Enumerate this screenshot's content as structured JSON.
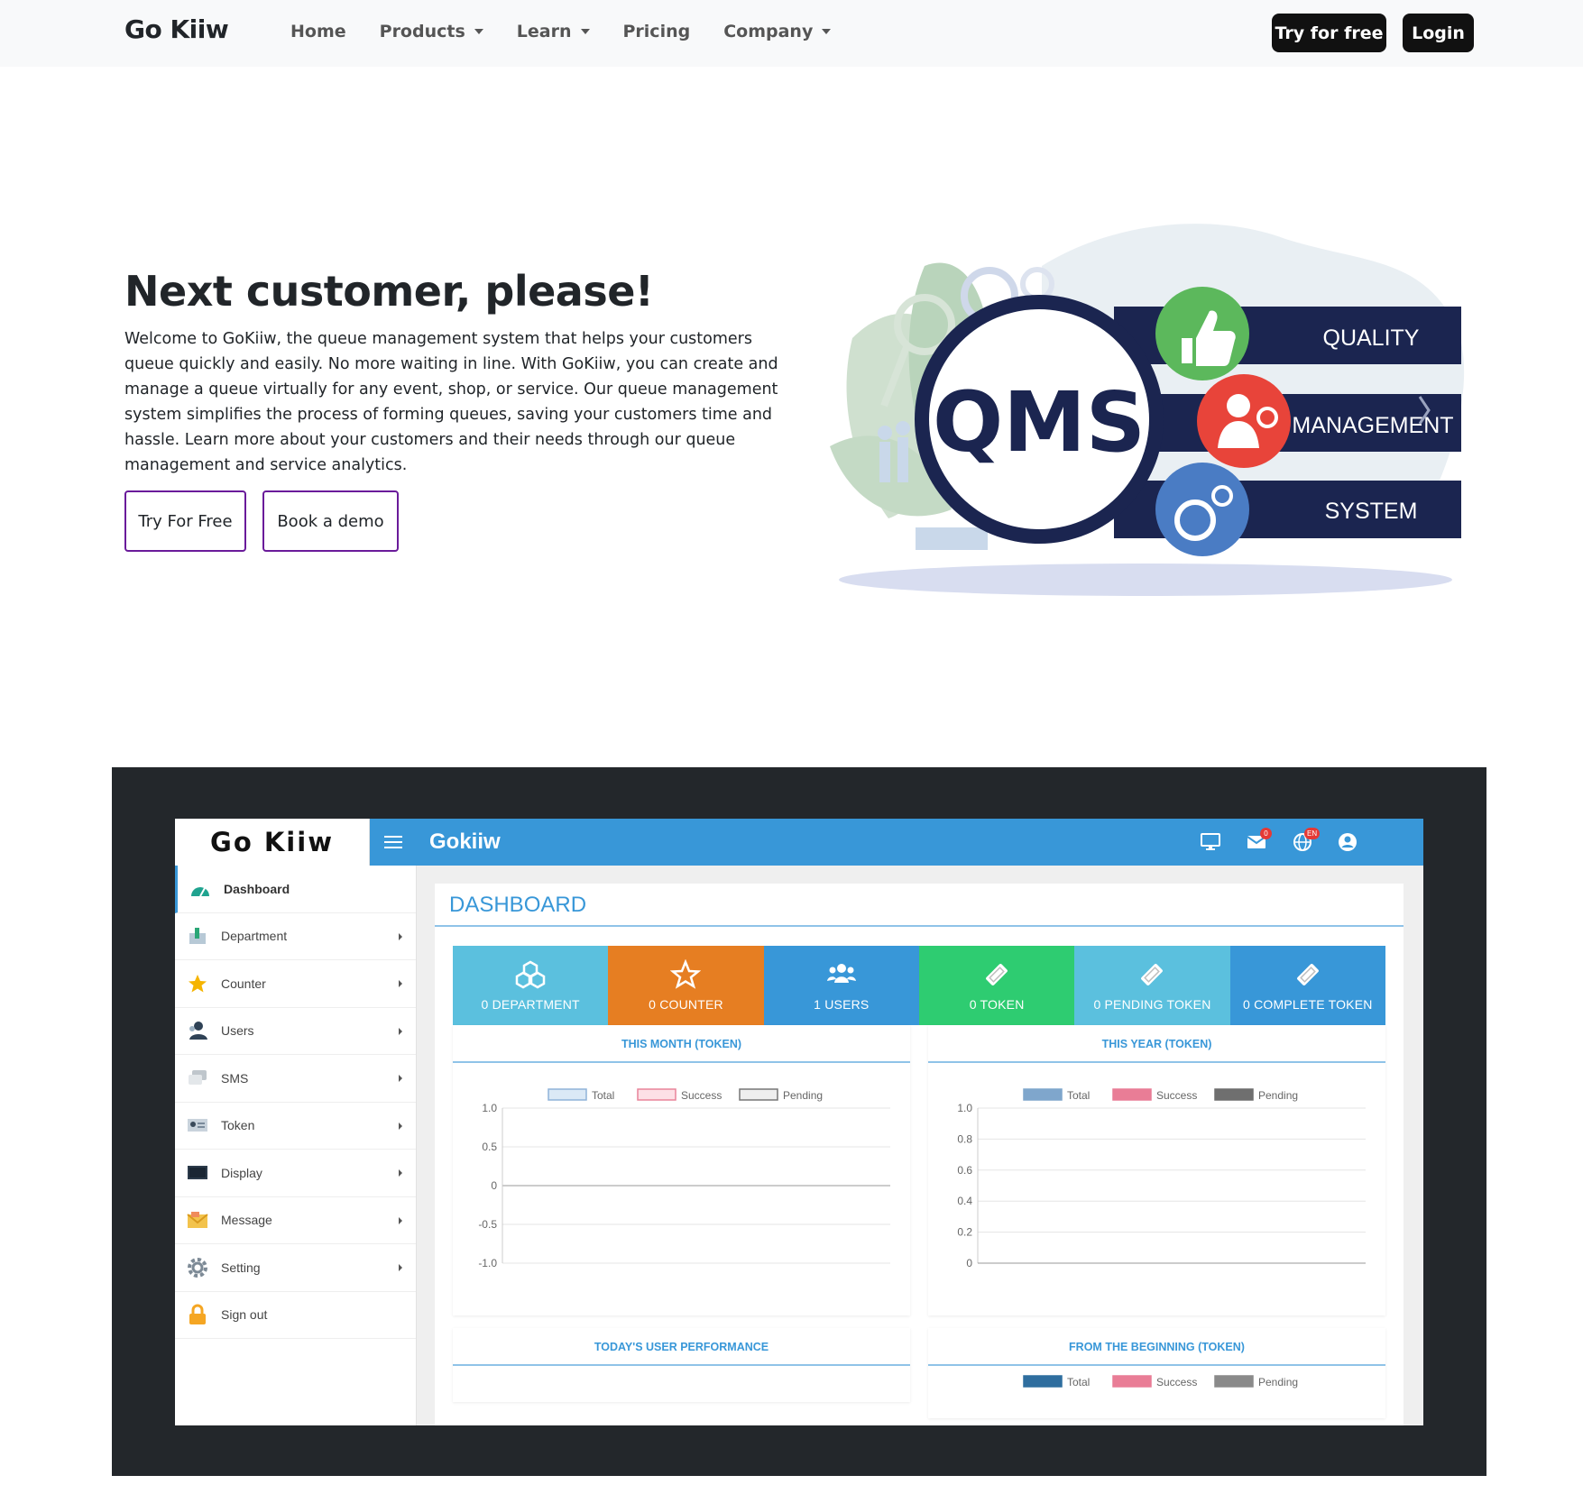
{
  "navbar": {
    "brand": "Go Kiiw",
    "links": [
      {
        "label": "Home",
        "dropdown": false
      },
      {
        "label": "Products",
        "dropdown": true
      },
      {
        "label": "Learn",
        "dropdown": true
      },
      {
        "label": "Pricing",
        "dropdown": false
      },
      {
        "label": "Company",
        "dropdown": true
      }
    ],
    "try_label": "Try for free",
    "login_label": "Login"
  },
  "hero": {
    "title": "Next customer, please!",
    "text": "Welcome to GoKiiw, the queue management system that helps your customers queue quickly and easily. No more waiting in line. With GoKiiw, you can create and manage a queue virtually for any event, shop, or service. Our queue management system simplifies the process of forming queues, saving your customers time and hassle. Learn more about your customers and their needs through our queue management and service analytics.",
    "btn_try": "Try For Free",
    "btn_demo": "Book a demo",
    "illustration": {
      "center": "QMS",
      "bands": [
        "QUALITY",
        "MANAGEMENT",
        "SYSTEM"
      ],
      "colors": {
        "navy": "#1b2550",
        "green": "#5cb85c",
        "red": "#e8443a",
        "blue": "#4a7cc4"
      }
    }
  },
  "app": {
    "logo": "Go Kiiw",
    "title": "Gokiiw",
    "mail_badge": "0",
    "lang_badge": "EN",
    "accent": "#3897d8",
    "sidebar": [
      {
        "label": "Dashboard",
        "icon": "dashboard-icon",
        "active": true,
        "arrow": false
      },
      {
        "label": "Department",
        "icon": "department-icon",
        "active": false,
        "arrow": true
      },
      {
        "label": "Counter",
        "icon": "star-icon",
        "active": false,
        "arrow": true
      },
      {
        "label": "Users",
        "icon": "users-icon",
        "active": false,
        "arrow": true
      },
      {
        "label": "SMS",
        "icon": "sms-icon",
        "active": false,
        "arrow": true
      },
      {
        "label": "Token",
        "icon": "token-icon",
        "active": false,
        "arrow": true
      },
      {
        "label": "Display",
        "icon": "display-icon",
        "active": false,
        "arrow": true
      },
      {
        "label": "Message",
        "icon": "message-icon",
        "active": false,
        "arrow": true
      },
      {
        "label": "Setting",
        "icon": "gear-icon",
        "active": false,
        "arrow": true
      },
      {
        "label": "Sign out",
        "icon": "lock-icon",
        "active": false,
        "arrow": false
      }
    ],
    "dashboard_title": "DASHBOARD",
    "stats": [
      {
        "label": "0 DEPARTMENT",
        "icon": "cubes-icon",
        "color": "#5bc0de"
      },
      {
        "label": "0 COUNTER",
        "icon": "star-outline-icon",
        "color": "#e67e22"
      },
      {
        "label": "1 USERS",
        "icon": "users-icon",
        "color": "#3897d8"
      },
      {
        "label": "0 TOKEN",
        "icon": "ticket-icon",
        "color": "#2ecc71"
      },
      {
        "label": "0 PENDING TOKEN",
        "icon": "ticket-icon",
        "color": "#5bc0de"
      },
      {
        "label": "0 COMPLETE TOKEN",
        "icon": "ticket-icon",
        "color": "#3897d8"
      }
    ],
    "cards": {
      "month_title": "THIS MONTH (TOKEN)",
      "year_title": "THIS YEAR (TOKEN)",
      "performance_title": "TODAY'S USER PERFORMANCE",
      "beginning_title": "FROM THE BEGINNING (TOKEN)"
    }
  },
  "chart_data": [
    {
      "type": "line",
      "title": "THIS MONTH (TOKEN)",
      "series": [
        {
          "name": "Total",
          "values": [],
          "color": "#dbe9f6",
          "border": "#8fb3d9"
        },
        {
          "name": "Success",
          "values": [],
          "color": "#fde0e6",
          "border": "#e8849a"
        },
        {
          "name": "Pending",
          "values": [],
          "color": "#eeeeee",
          "border": "#777777"
        }
      ],
      "yticks": [
        "1.0",
        "0.5",
        "0",
        "-0.5",
        "-1.0"
      ],
      "ylim": [
        -1.0,
        1.0
      ],
      "grid": true,
      "legend": "top"
    },
    {
      "type": "bar",
      "title": "THIS YEAR (TOKEN)",
      "series": [
        {
          "name": "Total",
          "values": [],
          "color": "#7fa6cc"
        },
        {
          "name": "Success",
          "values": [],
          "color": "#e97d96"
        },
        {
          "name": "Pending",
          "values": [],
          "color": "#6f6f6f"
        }
      ],
      "yticks": [
        "1.0",
        "0.8",
        "0.6",
        "0.4",
        "0.2",
        "0"
      ],
      "ylim": [
        0,
        1.0
      ],
      "grid": true,
      "legend": "top"
    },
    {
      "type": "bar",
      "title": "FROM THE BEGINNING (TOKEN)",
      "series": [
        {
          "name": "Total",
          "values": [],
          "color": "#2f6e9f"
        },
        {
          "name": "Success",
          "values": [],
          "color": "#e97d96"
        },
        {
          "name": "Pending",
          "values": [],
          "color": "#8a8a8a"
        }
      ],
      "legend": "top"
    }
  ]
}
